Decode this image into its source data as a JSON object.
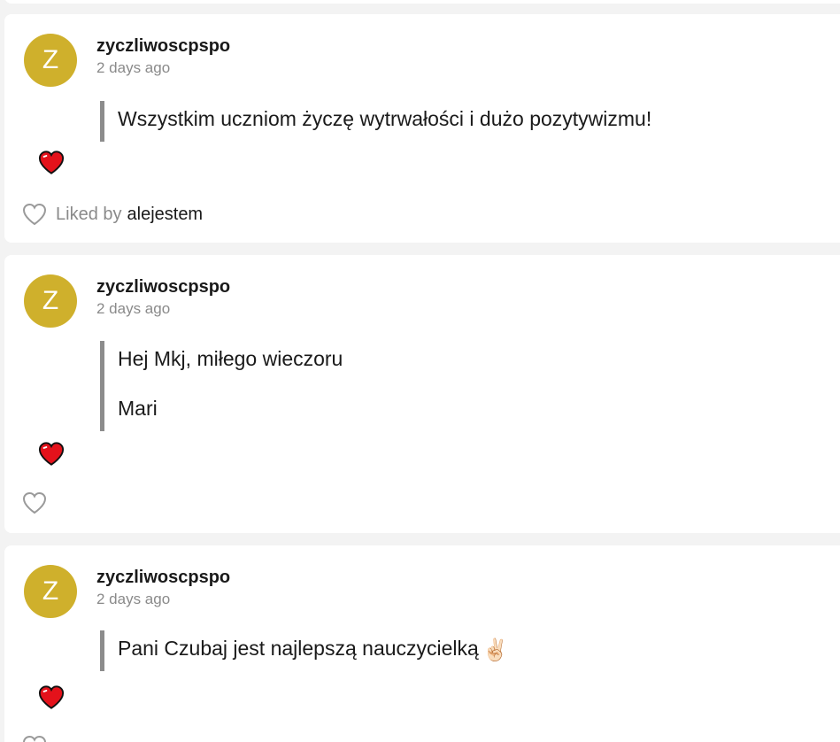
{
  "colors": {
    "avatar": "#cfb02c",
    "page_background": "#f3f3f3",
    "reaction_heart": "#e4121b",
    "quote_bar": "#8c8c8c"
  },
  "posts": [
    {
      "avatar_letter": "Z",
      "author": "zyczliwoscpspo",
      "time": "2 days ago",
      "paragraphs": [
        "Wszystkim uczniom życzę wytrwałości i dużo pozytywizmu!"
      ],
      "reaction_icon": "red-heart-icon",
      "liked_by_label": "Liked by",
      "liked_by_user": "alejestem"
    },
    {
      "avatar_letter": "Z",
      "author": "zyczliwoscpspo",
      "time": "2 days ago",
      "paragraphs": [
        "Hej Mkj, miłego wieczoru",
        "Mari"
      ],
      "reaction_icon": "red-heart-icon"
    },
    {
      "avatar_letter": "Z",
      "author": "zyczliwoscpspo",
      "time": "2 days ago",
      "paragraphs": [
        "Pani Czubaj jest najlepszą nauczycielką"
      ],
      "emoji": "✌🏻",
      "reaction_icon": "red-heart-icon"
    }
  ]
}
